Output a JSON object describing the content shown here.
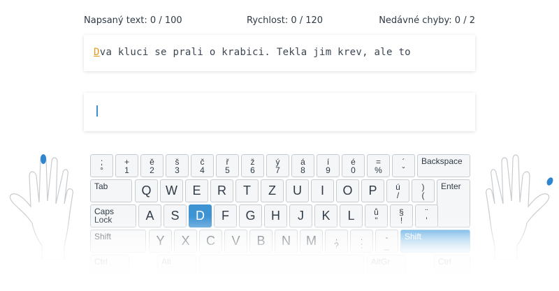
{
  "stats": {
    "typed": "Napsaný text: 0 / 100",
    "speed": "Rychlost: 0 / 120",
    "errors": "Nedávné chyby: 0 / 2"
  },
  "target_text": {
    "current_char": "D",
    "rest": "va kluci se prali o krabici. Tekla jim krev, ale to"
  },
  "input_value": "",
  "keyboard": {
    "row1": [
      {
        "top": ";",
        "bottom": "°"
      },
      {
        "top": "+",
        "bottom": "1"
      },
      {
        "top": "ě",
        "bottom": "2"
      },
      {
        "top": "š",
        "bottom": "3"
      },
      {
        "top": "č",
        "bottom": "4"
      },
      {
        "top": "ř",
        "bottom": "5"
      },
      {
        "top": "ž",
        "bottom": "6"
      },
      {
        "top": "ý",
        "bottom": "7"
      },
      {
        "top": "á",
        "bottom": "8"
      },
      {
        "top": "í",
        "bottom": "9"
      },
      {
        "top": "é",
        "bottom": "0"
      },
      {
        "top": "=",
        "bottom": "%"
      },
      {
        "top": "´",
        "bottom": "ˇ"
      }
    ],
    "backspace": "Backspace",
    "tab": "Tab",
    "row2": [
      "Q",
      "W",
      "E",
      "R",
      "T",
      "Z",
      "U",
      "I",
      "O",
      "P"
    ],
    "row2_extra": [
      {
        "top": "ú",
        "bottom": "/"
      },
      {
        "top": ")",
        "bottom": "("
      }
    ],
    "enter": "Enter",
    "caps": "Caps Lock",
    "row3": [
      "A",
      "S",
      "D",
      "F",
      "G",
      "H",
      "J",
      "K",
      "L"
    ],
    "row3_extra": [
      {
        "top": "ů",
        "bottom": "\""
      },
      {
        "top": "§",
        "bottom": "!"
      },
      {
        "top": "¨",
        "bottom": "'"
      }
    ],
    "shift_left": "Shift",
    "row4": [
      "Y",
      "X",
      "C",
      "V",
      "B",
      "N",
      "M"
    ],
    "row4_extra": [
      {
        "top": ",",
        "bottom": "?"
      },
      {
        "top": ".",
        "bottom": ":"
      },
      {
        "top": "-",
        "bottom": "_"
      }
    ],
    "shift_right": "Shift",
    "row5": [
      "Ctrl",
      "Alt",
      "AltGr",
      "Ctrl"
    ],
    "active_key": "D",
    "active_shift": "right"
  },
  "hands": {
    "left_active_finger": "pinky",
    "right_active_finger": "pinky",
    "highlight_color": "#2f86cf"
  }
}
